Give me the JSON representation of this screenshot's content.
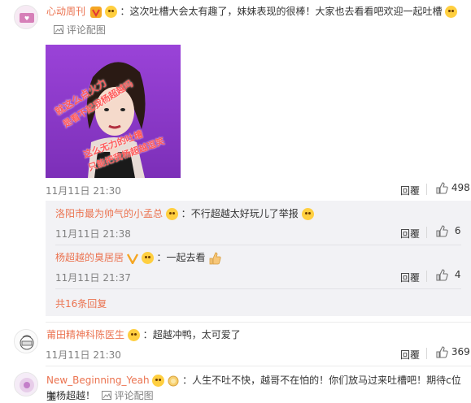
{
  "comments": [
    {
      "user": "心动周刊",
      "text": "这次吐槽大会太有趣了，妹妹表现的很棒！大家也去看看吧欢迎一起吐槽",
      "pic_link": "评论配图",
      "image_text_1": "就这么点火力",
      "image_text_2": "是看不起我杨超越吗",
      "image_text_3": "这么无力的吐槽",
      "image_text_4": "只能把我杨超越逗笑",
      "time": "11月11日 21:30",
      "reply": "回覆",
      "likes": "498"
    },
    {
      "user": "莆田精神科陈医生",
      "text": "超越冲鸭，太可爱了",
      "time": "11月11日 21:30",
      "reply": "回覆",
      "likes": "369"
    },
    {
      "user": "New_Beginning_Yeah",
      "text": "人生不吐不快，越哥不在怕的！你们放马过来吐槽吧！期待c位主",
      "text2": "咖杨超越！",
      "pic_link": "评论配图"
    }
  ],
  "replies": [
    {
      "user": "洛阳市最为帅气的小孟总",
      "text": "不行超越太好玩儿了举报",
      "time": "11月11日 21:38",
      "reply": "回覆",
      "likes": "6"
    },
    {
      "user": "杨超越的臭居居",
      "text": "一起去看",
      "time": "11月11日 21:37",
      "reply": "回覆",
      "likes": "4"
    }
  ],
  "more_replies": "共16条回复",
  "colors": {
    "username": "#eb7350",
    "reply_bg": "#f2f2f5",
    "vip_badge": "#f5a623",
    "vip_v_red": "#e33535"
  }
}
